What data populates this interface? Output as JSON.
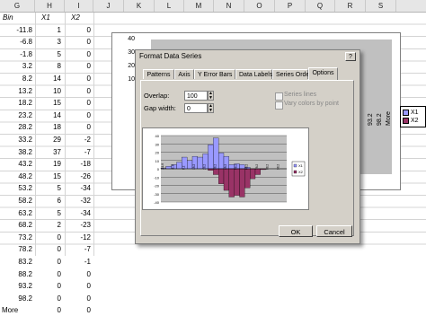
{
  "columns": [
    "G",
    "H",
    "I",
    "J",
    "K",
    "L",
    "M",
    "N",
    "O",
    "P",
    "Q",
    "R",
    "S"
  ],
  "sheet": {
    "headers": {
      "bin": "Bin",
      "x1": "X1",
      "x2": "X2"
    },
    "rows": [
      [
        "-11.8",
        "1",
        "0"
      ],
      [
        "-6.8",
        "3",
        "0"
      ],
      [
        "-1.8",
        "5",
        "0"
      ],
      [
        "3.2",
        "8",
        "0"
      ],
      [
        "8.2",
        "14",
        "0"
      ],
      [
        "13.2",
        "10",
        "0"
      ],
      [
        "18.2",
        "15",
        "0"
      ],
      [
        "23.2",
        "14",
        "0"
      ],
      [
        "28.2",
        "18",
        "0"
      ],
      [
        "33.2",
        "29",
        "-2"
      ],
      [
        "38.2",
        "37",
        "-7"
      ],
      [
        "43.2",
        "19",
        "-18"
      ],
      [
        "48.2",
        "15",
        "-26"
      ],
      [
        "53.2",
        "5",
        "-34"
      ],
      [
        "58.2",
        "6",
        "-32"
      ],
      [
        "63.2",
        "5",
        "-34"
      ],
      [
        "68.2",
        "2",
        "-23"
      ],
      [
        "73.2",
        "0",
        "-12"
      ],
      [
        "78.2",
        "0",
        "-7"
      ],
      [
        "83.2",
        "0",
        "-1"
      ],
      [
        "88.2",
        "0",
        "0"
      ],
      [
        "93.2",
        "0",
        "0"
      ],
      [
        "98.2",
        "0",
        "0"
      ],
      [
        "More",
        "0",
        "0"
      ]
    ]
  },
  "bg_chart": {
    "yticks": [
      "40",
      "30",
      "20",
      "10"
    ],
    "xlabels": [
      "93.2",
      "98.2",
      "More"
    ],
    "legend": [
      "X1",
      "X2"
    ]
  },
  "dialog": {
    "title": "Format Data Series",
    "tabs": [
      "Patterns",
      "Axis",
      "Y Error Bars",
      "Data Labels",
      "Series Order",
      "Options"
    ],
    "active_tab": "Options",
    "overlap_label": "Overlap:",
    "overlap_value": "100",
    "gap_label": "Gap width:",
    "gap_value": "0",
    "series_lines_label": "Series lines",
    "vary_colors_label": "Vary colors by point",
    "ok_label": "OK",
    "cancel_label": "Cancel",
    "preview_yticks": [
      "40",
      "30",
      "20",
      "10",
      "0",
      "-10",
      "-20",
      "-30",
      "-40"
    ],
    "preview_legend": [
      "X1",
      "X2"
    ]
  },
  "colors": {
    "x1": "#9999ff",
    "x2": "#993366",
    "plot_bg": "#c0c0c0",
    "dialog_bg": "#d4d0c8"
  },
  "chart_data": {
    "type": "bar",
    "categories": [
      "-11.8",
      "-6.8",
      "-1.8",
      "3.2",
      "8.2",
      "13.2",
      "18.2",
      "23.2",
      "28.2",
      "33.2",
      "38.2",
      "43.2",
      "48.2",
      "53.2",
      "58.2",
      "63.2",
      "68.2",
      "73.2",
      "78.2",
      "83.2",
      "88.2",
      "93.2",
      "98.2",
      "More"
    ],
    "series": [
      {
        "name": "X1",
        "values": [
          1,
          3,
          5,
          8,
          14,
          10,
          15,
          14,
          18,
          29,
          37,
          19,
          15,
          5,
          6,
          5,
          2,
          0,
          0,
          0,
          0,
          0,
          0,
          0
        ]
      },
      {
        "name": "X2",
        "values": [
          0,
          0,
          0,
          0,
          0,
          0,
          0,
          0,
          0,
          -2,
          -7,
          -18,
          -26,
          -34,
          -32,
          -34,
          -23,
          -12,
          -7,
          -1,
          0,
          0,
          0,
          0
        ]
      }
    ],
    "ylim": [
      -40,
      40
    ]
  }
}
